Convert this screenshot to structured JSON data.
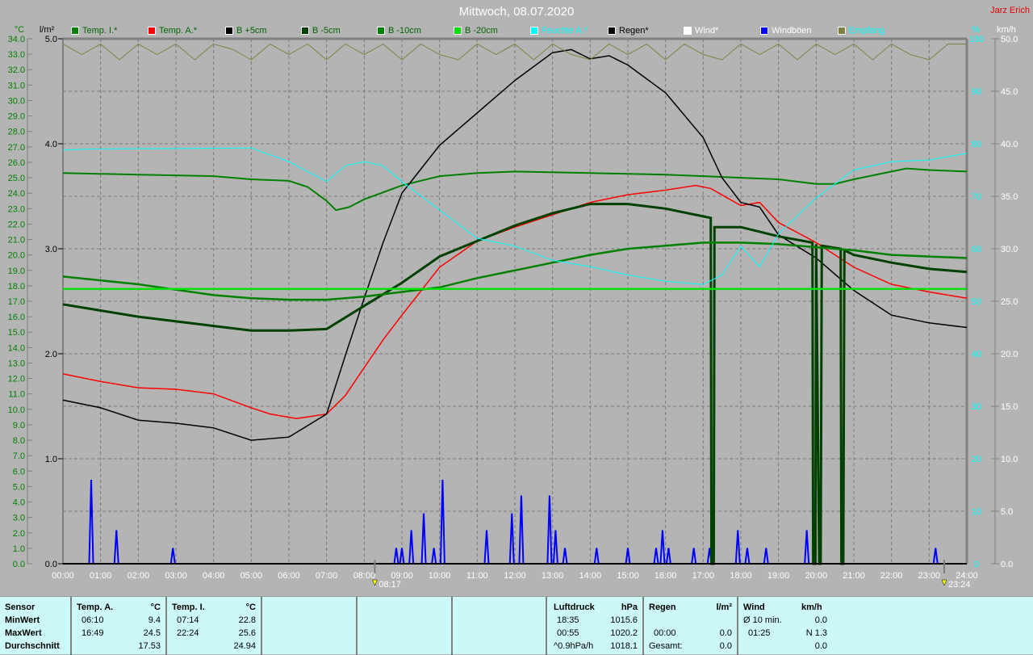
{
  "header": {
    "title": "Mittwoch, 08.07.2020",
    "author": "Jarz Erich"
  },
  "legend": [
    {
      "label": "Temp. I.*",
      "color": "#008000",
      "text": "#006400"
    },
    {
      "label": "Temp. A.*",
      "color": "#ff0000",
      "text": "#006400"
    },
    {
      "label": "B +5cm",
      "color": "#000000",
      "text": "#006400"
    },
    {
      "label": "B -5cm",
      "color": "#004000",
      "text": "#006400"
    },
    {
      "label": "B -10cm",
      "color": "#008000",
      "text": "#006400"
    },
    {
      "label": "B -20cm",
      "color": "#00e000",
      "text": "#006400"
    },
    {
      "label": "Feuchte A.*",
      "color": "#00ffff",
      "text": "#00ffff"
    },
    {
      "label": "Regen*",
      "color": "#000000",
      "text": "#000000"
    },
    {
      "label": "Wind*",
      "color": "#ffffff",
      "text": "#ffffff"
    },
    {
      "label": "Windböen",
      "color": "#0000ff",
      "text": "#ffffff"
    },
    {
      "label": "Empfang",
      "color": "#808040",
      "text": "#00ffff"
    }
  ],
  "chart_data": {
    "type": "line",
    "title": "Mittwoch, 08.07.2020",
    "x_ticks": [
      "00:00",
      "01:00",
      "02:00",
      "03:00",
      "04:00",
      "05:00",
      "06:00",
      "07:00",
      "08:00",
      "09:00",
      "10:00",
      "11:00",
      "12:00",
      "13:00",
      "14:00",
      "15:00",
      "16:00",
      "17:00",
      "18:00",
      "19:00",
      "20:00",
      "21:00",
      "22:00",
      "23:00",
      "24:00"
    ],
    "xlim": [
      0,
      24
    ],
    "axes": {
      "temp": {
        "label": "°C",
        "ylim": [
          0,
          34
        ],
        "step": 1
      },
      "rain": {
        "label": "l/m²",
        "ylim": [
          0,
          5
        ],
        "step": 1
      },
      "humidity": {
        "label": "%",
        "ylim": [
          0,
          100
        ],
        "step": 10
      },
      "wind": {
        "label": "km/h",
        "ylim": [
          0,
          50
        ],
        "step": 5
      }
    },
    "markers": [
      {
        "label": "08:17",
        "time": 8.28
      },
      {
        "label": "23:24",
        "time": 23.4
      }
    ],
    "series": [
      {
        "name": "Temp. I.*",
        "axis": "temp",
        "color": "#008000",
        "width": 2,
        "points": [
          [
            0,
            25.3
          ],
          [
            2,
            25.2
          ],
          [
            4,
            25.1
          ],
          [
            5,
            24.9
          ],
          [
            6,
            24.8
          ],
          [
            6.5,
            24.4
          ],
          [
            7,
            23.5
          ],
          [
            7.25,
            22.9
          ],
          [
            7.6,
            23.1
          ],
          [
            8,
            23.6
          ],
          [
            9,
            24.5
          ],
          [
            10,
            25.1
          ],
          [
            11,
            25.3
          ],
          [
            12,
            25.4
          ],
          [
            14,
            25.3
          ],
          [
            16,
            25.2
          ],
          [
            18,
            25.0
          ],
          [
            19,
            24.9
          ],
          [
            20,
            24.6
          ],
          [
            20.5,
            24.6
          ],
          [
            21,
            24.9
          ],
          [
            22,
            25.4
          ],
          [
            22.4,
            25.6
          ],
          [
            23,
            25.5
          ],
          [
            24,
            25.4
          ]
        ]
      },
      {
        "name": "Temp. A.*",
        "axis": "temp",
        "color": "#ff0000",
        "width": 1.5,
        "points": [
          [
            0,
            12.3
          ],
          [
            1,
            11.8
          ],
          [
            2,
            11.4
          ],
          [
            3,
            11.3
          ],
          [
            4,
            11.0
          ],
          [
            5,
            10.1
          ],
          [
            5.5,
            9.7
          ],
          [
            6.2,
            9.4
          ],
          [
            7,
            9.7
          ],
          [
            7.5,
            10.9
          ],
          [
            8,
            12.7
          ],
          [
            8.5,
            14.5
          ],
          [
            9,
            16.1
          ],
          [
            10,
            19.2
          ],
          [
            11,
            20.9
          ],
          [
            12,
            21.8
          ],
          [
            13,
            22.6
          ],
          [
            14,
            23.4
          ],
          [
            15,
            23.9
          ],
          [
            16,
            24.2
          ],
          [
            16.8,
            24.5
          ],
          [
            17.2,
            24.3
          ],
          [
            18,
            23.2
          ],
          [
            18.5,
            23.4
          ],
          [
            19,
            22.1
          ],
          [
            20,
            20.8
          ],
          [
            21,
            19.2
          ],
          [
            22,
            18.1
          ],
          [
            23,
            17.6
          ],
          [
            24,
            17.2
          ]
        ]
      },
      {
        "name": "B +5cm",
        "axis": "temp",
        "color": "#000000",
        "width": 1.5,
        "points": [
          [
            0,
            10.6
          ],
          [
            1,
            10.1
          ],
          [
            2,
            9.3
          ],
          [
            3,
            9.1
          ],
          [
            4,
            8.8
          ],
          [
            5,
            8.0
          ],
          [
            6,
            8.2
          ],
          [
            7,
            9.7
          ],
          [
            7.5,
            13.5
          ],
          [
            8,
            17.2
          ],
          [
            8.5,
            20.8
          ],
          [
            9,
            24.0
          ],
          [
            10,
            27.1
          ],
          [
            11,
            29.2
          ],
          [
            12,
            31.3
          ],
          [
            13,
            33.1
          ],
          [
            13.5,
            33.3
          ],
          [
            14,
            32.7
          ],
          [
            14.5,
            32.9
          ],
          [
            15,
            32.3
          ],
          [
            16,
            30.5
          ],
          [
            17,
            27.6
          ],
          [
            17.5,
            25.0
          ],
          [
            18,
            23.4
          ],
          [
            18.5,
            23.1
          ],
          [
            19,
            21.3
          ],
          [
            20,
            19.8
          ],
          [
            21,
            17.7
          ],
          [
            22,
            16.1
          ],
          [
            23,
            15.6
          ],
          [
            24,
            15.3
          ]
        ]
      },
      {
        "name": "B -5cm",
        "axis": "temp",
        "color": "#004000",
        "width": 3,
        "points": [
          [
            0,
            16.8
          ],
          [
            1,
            16.4
          ],
          [
            2,
            16.0
          ],
          [
            3,
            15.7
          ],
          [
            4,
            15.4
          ],
          [
            5,
            15.1
          ],
          [
            6,
            15.1
          ],
          [
            7,
            15.2
          ],
          [
            8,
            16.7
          ],
          [
            9,
            18.2
          ],
          [
            10,
            19.9
          ],
          [
            11,
            20.9
          ],
          [
            12,
            21.9
          ],
          [
            13,
            22.7
          ],
          [
            14,
            23.3
          ],
          [
            15,
            23.3
          ],
          [
            16,
            23.0
          ],
          [
            17,
            22.5
          ],
          [
            17.2,
            22.4
          ],
          [
            17.22,
            0
          ],
          [
            17.28,
            0
          ],
          [
            17.3,
            21.8
          ],
          [
            18,
            21.8
          ],
          [
            19,
            21.2
          ],
          [
            19.9,
            20.8
          ],
          [
            19.92,
            0
          ],
          [
            19.98,
            0
          ],
          [
            20.0,
            20.7
          ],
          [
            20.08,
            0
          ],
          [
            20.12,
            0
          ],
          [
            20.15,
            20.6
          ],
          [
            20.65,
            20.4
          ],
          [
            20.67,
            0
          ],
          [
            20.72,
            0
          ],
          [
            20.75,
            20.3
          ],
          [
            21,
            20.0
          ],
          [
            22,
            19.5
          ],
          [
            23,
            19.1
          ],
          [
            24,
            18.9
          ]
        ]
      },
      {
        "name": "B -10cm",
        "axis": "temp",
        "color": "#008000",
        "width": 2.5,
        "points": [
          [
            0,
            18.6
          ],
          [
            2,
            18.1
          ],
          [
            4,
            17.4
          ],
          [
            5,
            17.2
          ],
          [
            6,
            17.1
          ],
          [
            7,
            17.1
          ],
          [
            8,
            17.3
          ],
          [
            9,
            17.6
          ],
          [
            10,
            17.9
          ],
          [
            11,
            18.5
          ],
          [
            12,
            19.0
          ],
          [
            13,
            19.5
          ],
          [
            14,
            20.0
          ],
          [
            15,
            20.4
          ],
          [
            16,
            20.6
          ],
          [
            17,
            20.8
          ],
          [
            18,
            20.8
          ],
          [
            19,
            20.7
          ],
          [
            20,
            20.5
          ],
          [
            21,
            20.3
          ],
          [
            22,
            20.0
          ],
          [
            23,
            19.9
          ],
          [
            24,
            19.8
          ]
        ]
      },
      {
        "name": "B -20cm",
        "axis": "temp",
        "color": "#00e000",
        "width": 2.5,
        "points": [
          [
            0,
            17.8
          ],
          [
            24,
            17.8
          ]
        ]
      },
      {
        "name": "Feuchte A.*",
        "axis": "humidity",
        "color": "#00ffff",
        "width": 1,
        "points": [
          [
            0,
            78.8
          ],
          [
            0.7,
            79.0
          ],
          [
            5,
            79.2
          ],
          [
            6,
            76.6
          ],
          [
            7,
            72.8
          ],
          [
            7.5,
            75.8
          ],
          [
            8,
            76.6
          ],
          [
            8.5,
            75.8
          ],
          [
            9,
            72.8
          ],
          [
            10,
            67.4
          ],
          [
            11,
            62.0
          ],
          [
            12,
            60.5
          ],
          [
            13,
            57.8
          ],
          [
            14,
            56.6
          ],
          [
            15,
            55.0
          ],
          [
            16,
            53.8
          ],
          [
            17,
            53.2
          ],
          [
            17.5,
            55.0
          ],
          [
            18,
            60.5
          ],
          [
            18.5,
            56.6
          ],
          [
            19,
            62.8
          ],
          [
            20,
            69.7
          ],
          [
            21,
            75.0
          ],
          [
            22,
            76.6
          ],
          [
            23,
            76.9
          ],
          [
            24,
            78.2
          ]
        ]
      },
      {
        "name": "Empfang",
        "axis": "humidity",
        "color": "#808040",
        "width": 1,
        "points": [
          [
            0,
            99
          ],
          [
            0.5,
            97
          ],
          [
            1,
            99
          ],
          [
            1.5,
            96
          ],
          [
            2,
            99
          ],
          [
            2.5,
            97
          ],
          [
            3,
            99
          ],
          [
            3.5,
            96
          ],
          [
            4,
            99
          ],
          [
            4.5,
            98
          ],
          [
            5,
            96
          ],
          [
            5.5,
            99
          ],
          [
            6,
            97
          ],
          [
            6.5,
            99
          ],
          [
            7,
            96
          ],
          [
            7.5,
            99
          ],
          [
            8,
            97
          ],
          [
            8.5,
            99
          ],
          [
            9,
            96
          ],
          [
            9.5,
            99
          ],
          [
            10,
            97
          ],
          [
            10.5,
            96
          ],
          [
            11,
            99
          ],
          [
            11.5,
            97
          ],
          [
            12,
            99
          ],
          [
            12.5,
            96
          ],
          [
            13,
            99
          ],
          [
            13.5,
            97
          ],
          [
            14,
            96
          ],
          [
            14.5,
            99
          ],
          [
            15,
            97
          ],
          [
            15.5,
            99
          ],
          [
            16,
            96
          ],
          [
            16.5,
            99
          ],
          [
            17,
            97
          ],
          [
            17.5,
            96
          ],
          [
            18,
            99
          ],
          [
            18.5,
            97
          ],
          [
            19,
            99
          ],
          [
            19.5,
            96
          ],
          [
            20,
            99
          ],
          [
            20.5,
            97
          ],
          [
            21,
            99
          ],
          [
            21.5,
            96
          ],
          [
            22,
            99
          ],
          [
            22.5,
            97
          ],
          [
            23,
            96
          ],
          [
            23.5,
            99
          ],
          [
            24,
            99
          ]
        ]
      }
    ],
    "gusts": {
      "name": "Windböen",
      "axis": "wind",
      "color": "#0000ff",
      "points": [
        [
          0.75,
          8.0
        ],
        [
          1.42,
          3.2
        ],
        [
          2.92,
          1.5
        ],
        [
          8.85,
          1.5
        ],
        [
          9.0,
          1.5
        ],
        [
          9.25,
          3.2
        ],
        [
          9.58,
          4.8
        ],
        [
          9.85,
          1.5
        ],
        [
          10.08,
          8.0
        ],
        [
          11.25,
          3.2
        ],
        [
          11.92,
          4.8
        ],
        [
          12.17,
          6.5
        ],
        [
          12.92,
          6.5
        ],
        [
          13.08,
          3.2
        ],
        [
          13.33,
          1.5
        ],
        [
          14.17,
          1.5
        ],
        [
          15.0,
          1.5
        ],
        [
          15.75,
          1.5
        ],
        [
          15.92,
          3.2
        ],
        [
          16.08,
          1.5
        ],
        [
          16.75,
          1.5
        ],
        [
          17.17,
          1.5
        ],
        [
          17.92,
          3.2
        ],
        [
          18.17,
          1.5
        ],
        [
          18.67,
          1.5
        ],
        [
          19.75,
          3.2
        ],
        [
          23.17,
          1.5
        ]
      ]
    }
  },
  "table": {
    "sensor": {
      "header": "Sensor",
      "rows": [
        "MinWert",
        "MaxWert",
        "Durchschnitt"
      ]
    },
    "temp_a": {
      "header": "Temp. A.",
      "unit": "°C",
      "min_time": "06:10",
      "min": "9.4",
      "max_time": "16:49",
      "max": "24.5",
      "avg": "17.53"
    },
    "temp_i": {
      "header": "Temp. I.",
      "unit": "°C",
      "min_time": "07:14",
      "min": "22.8",
      "max_time": "22:24",
      "max": "25.6",
      "avg": "24.94"
    },
    "pressure": {
      "header": "Luftdruck",
      "unit": "hPa",
      "min_time": "18:35",
      "min": "1015.6",
      "max_time": "00:55",
      "max": "1020.2",
      "trend": "^0.9hPa/h",
      "avg": "1018.1"
    },
    "rain": {
      "header": "Regen",
      "unit": "l/m²",
      "max_time": "00:00",
      "max": "0.0",
      "total_label": "Gesamt:",
      "total": "0.0"
    },
    "wind": {
      "header": "Wind",
      "unit": "km/h",
      "avg_label": "Ø 10 min.",
      "avg": "0.0",
      "max_time": "01:25",
      "max": "N 1.3",
      "last": "0.0"
    }
  }
}
